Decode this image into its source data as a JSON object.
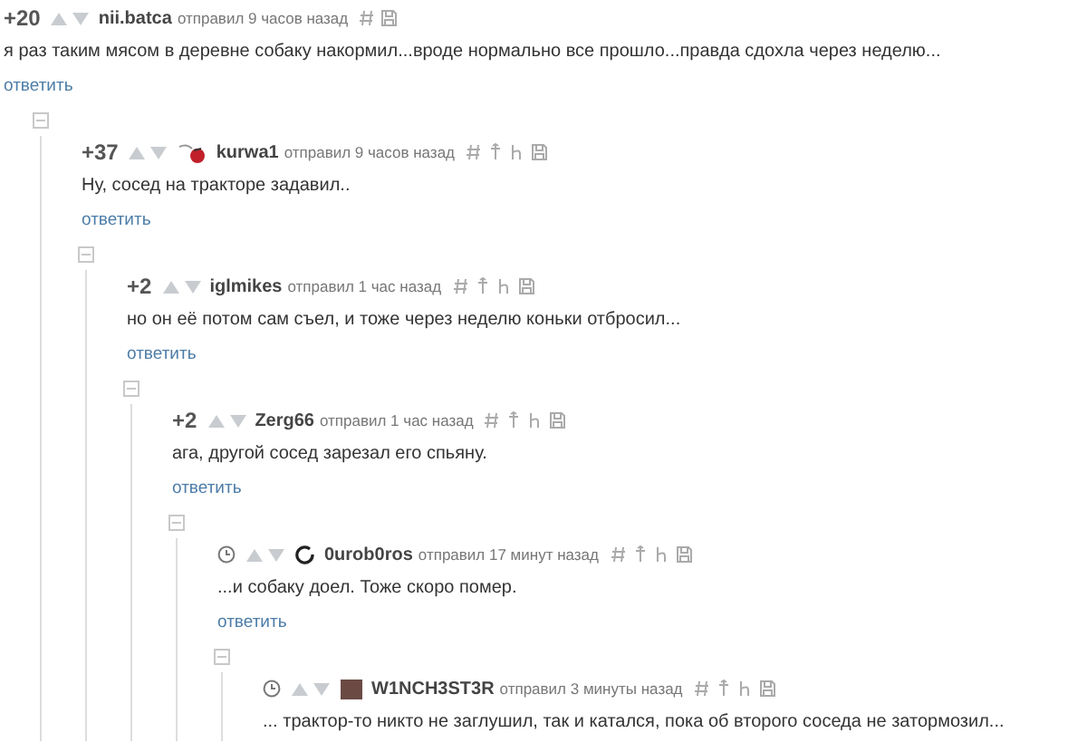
{
  "comment": {
    "score": "+20",
    "author": "nii.batca",
    "meta": "отправил 9 часов назад",
    "tools": [
      {
        "kind": "hash"
      },
      {
        "kind": "save"
      }
    ],
    "text": "я раз таким мясом в деревне собаку накормил...вроде нормально все прошло...правда сдохла через неделю...",
    "reply": "ответить",
    "expanded": true,
    "children": [
      {
        "score": "+37",
        "author": "kurwa1",
        "avatar": {
          "kind": "logo"
        },
        "meta": "отправил 9 часов назад",
        "tools": [
          {
            "kind": "hash"
          },
          {
            "kind": "pin"
          },
          {
            "kind": "branch"
          },
          {
            "kind": "save"
          }
        ],
        "text": "Ну, сосед на тракторе задавил..",
        "reply": "ответить",
        "expanded": true,
        "children": [
          {
            "score": "+2",
            "author": "iglmikes",
            "meta": "отправил 1 час назад",
            "tools": [
              {
                "kind": "hash"
              },
              {
                "kind": "pin"
              },
              {
                "kind": "branch"
              },
              {
                "kind": "save"
              }
            ],
            "text": "но он её потом сам съел, и тоже через неделю коньки отбросил...",
            "reply": "ответить",
            "expanded": true,
            "children": [
              {
                "score": "+2",
                "author": "Zerg66",
                "meta": "отправил 1 час назад",
                "tools": [
                  {
                    "kind": "hash"
                  },
                  {
                    "kind": "pin"
                  },
                  {
                    "kind": "branch"
                  },
                  {
                    "kind": "save"
                  }
                ],
                "text": "ага, другой сосед зарезал его спьяну.",
                "reply": "ответить",
                "expanded": true,
                "children": [
                  {
                    "author": "0urob0ros",
                    "avatar": {
                      "kind": "ring"
                    },
                    "meta": "отправил 17 минут назад",
                    "tools": [
                      {
                        "kind": "hash"
                      },
                      {
                        "kind": "pin"
                      },
                      {
                        "kind": "branch"
                      },
                      {
                        "kind": "save"
                      }
                    ],
                    "text": "...и собаку доел. Тоже скоро помер.",
                    "reply": "ответить",
                    "expanded": true,
                    "children": [
                      {
                        "author": "W1NCH3ST3R",
                        "avatar": {
                          "kind": "photo"
                        },
                        "meta": "отправил 3 минуты назад",
                        "tools": [
                          {
                            "kind": "hash"
                          },
                          {
                            "kind": "pin"
                          },
                          {
                            "kind": "branch"
                          },
                          {
                            "kind": "save"
                          }
                        ],
                        "text": "... трактор-то никто не заглушил, так и катался, пока об второго соседа не затормозил..."
                      }
                    ]
                  }
                ]
              }
            ]
          }
        ]
      }
    ]
  }
}
